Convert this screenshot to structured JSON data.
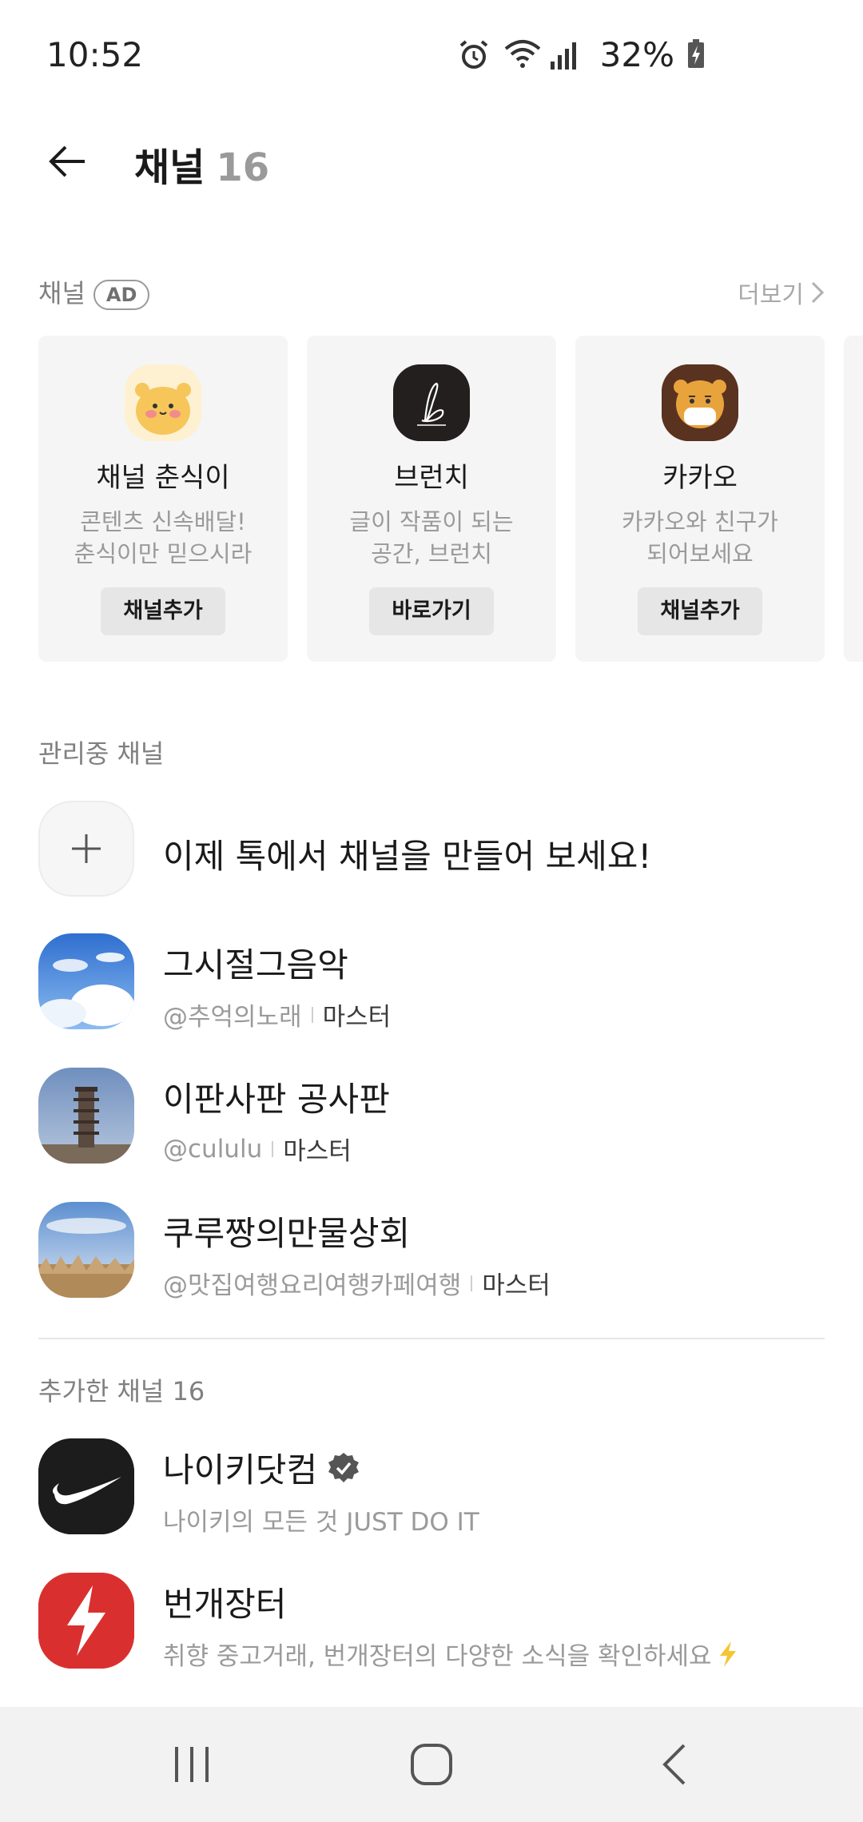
{
  "status_bar": {
    "time": "10:52",
    "battery": "32%",
    "icons": [
      "alarm-icon",
      "wifi-icon",
      "signal-icon",
      "battery-charging-icon"
    ]
  },
  "header": {
    "title": "채널",
    "count": "16"
  },
  "ad_section": {
    "label": "채널",
    "badge": "AD",
    "more": "더보기",
    "cards": [
      {
        "name": "채널 춘식이",
        "desc_line1": "콘텐츠 신속배달!",
        "desc_line2": "춘식이만 믿으시라",
        "button": "채널추가"
      },
      {
        "name": "브런치",
        "desc_line1": "글이 작품이 되는",
        "desc_line2": "공간, 브런치",
        "button": "바로가기"
      },
      {
        "name": "카카오",
        "desc_line1": "카카오와 친구가",
        "desc_line2": "되어보세요",
        "button": "채널추가"
      }
    ]
  },
  "managed_section": {
    "label": "관리중 채널",
    "create_text": "이제 톡에서 채널을 만들어 보세요!",
    "channels": [
      {
        "name": "그시절그음악",
        "handle": "@추억의노래",
        "role": "마스터"
      },
      {
        "name": "이판사판 공사판",
        "handle": "@cululu",
        "role": "마스터"
      },
      {
        "name": "쿠루짱의만물상회",
        "handle": "@맛집여행요리여행카페여행",
        "role": "마스터"
      }
    ]
  },
  "added_section": {
    "label": "추가한 채널",
    "count": "16",
    "channels": [
      {
        "name": "나이키닷컴",
        "desc": "나이키의 모든 것 JUST DO IT",
        "verified": true
      },
      {
        "name": "번개장터",
        "desc": "취향 중고거래, 번개장터의 다양한 소식을 확인하세요"
      }
    ]
  },
  "colors": {
    "accent_nike": "#1c1c1c",
    "accent_bunjang": "#d9302f",
    "brunch": "#231f1f"
  }
}
